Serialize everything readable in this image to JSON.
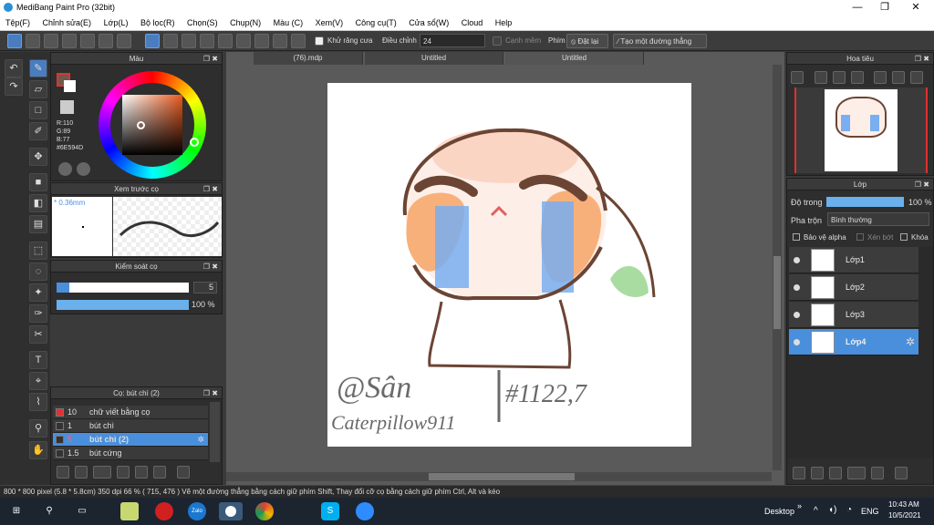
{
  "window": {
    "title": "MediBang Paint Pro (32bit)",
    "min": "—",
    "max": "❐",
    "close": "✕"
  },
  "menu": [
    "Tệp(F)",
    "Chỉnh sửa(E)",
    "Lớp(L)",
    "Bộ lọc(R)",
    "Chọn(S)",
    "Chụp(N)",
    "Màu (C)",
    "Xem(V)",
    "Công cụ(T)",
    "Cửa sổ(W)",
    "Cloud",
    "Help"
  ],
  "toolbar": {
    "antialias": "Khử răng cưa",
    "adjust_label": "Điều chỉnh",
    "adjust_value": "24",
    "edge_label": "Cạnh mềm",
    "pen_label": "Phím",
    "reset_label": "Đặt lại",
    "straight_label": "Tạo một đường thẳng"
  },
  "color_panel": {
    "title": "Màu",
    "r": "R:110",
    "g": "G:89",
    "b": "B:77",
    "hex": "#6E594D",
    "hue_color": "#e85a1e"
  },
  "brush_preview": {
    "title": "Xem trước cọ",
    "size": "* 0.36mm"
  },
  "brush_control": {
    "title": "Kiểm soát cọ",
    "size_value": "5",
    "opacity_value": "100 %"
  },
  "brush_list": {
    "title": "Cọ: bút chì (2)",
    "items": [
      {
        "size": "10",
        "name": "chữ viết bằng cọ",
        "color": "#e03030"
      },
      {
        "size": "1",
        "name": "bút chì",
        "color": "#333"
      },
      {
        "size": "5",
        "name": "bút chì (2)",
        "color": "#333"
      },
      {
        "size": "1.5",
        "name": "bút cứng",
        "color": "#333"
      }
    ]
  },
  "tabs": [
    "(76).mdp",
    "Untitled",
    "Untitled"
  ],
  "navigator": {
    "title": "Hoa tiêu"
  },
  "layer_panel": {
    "title": "Lớp",
    "opacity_label": "Độ trong",
    "opacity_value": "100 %",
    "blend_label": "Pha trộn",
    "blend_value": "Bình thường",
    "protect_alpha": "Bảo vệ alpha",
    "clipping": "Xén bớt",
    "lock": "Khóa",
    "layers": [
      "Lớp1",
      "Lớp2",
      "Lớp3",
      "Lớp4"
    ]
  },
  "canvas": {
    "sig1": "@Sân",
    "sig2": "Caterpillow911",
    "sig3": "#1122,7"
  },
  "status": {
    "text": "800 * 800 pixel   (5.8 * 5.8cm)   350 dpi   66 %   ( 715, 476 )   Vẽ một đường thẳng bằng cách giữ phím Shift, Thay đổi cỡ cọ bằng cách giữ phím Ctrl, Alt và kéo"
  },
  "taskbar": {
    "desktop": "Desktop",
    "lang": "ENG",
    "time": "10:43 AM",
    "date": "10/5/2021"
  }
}
